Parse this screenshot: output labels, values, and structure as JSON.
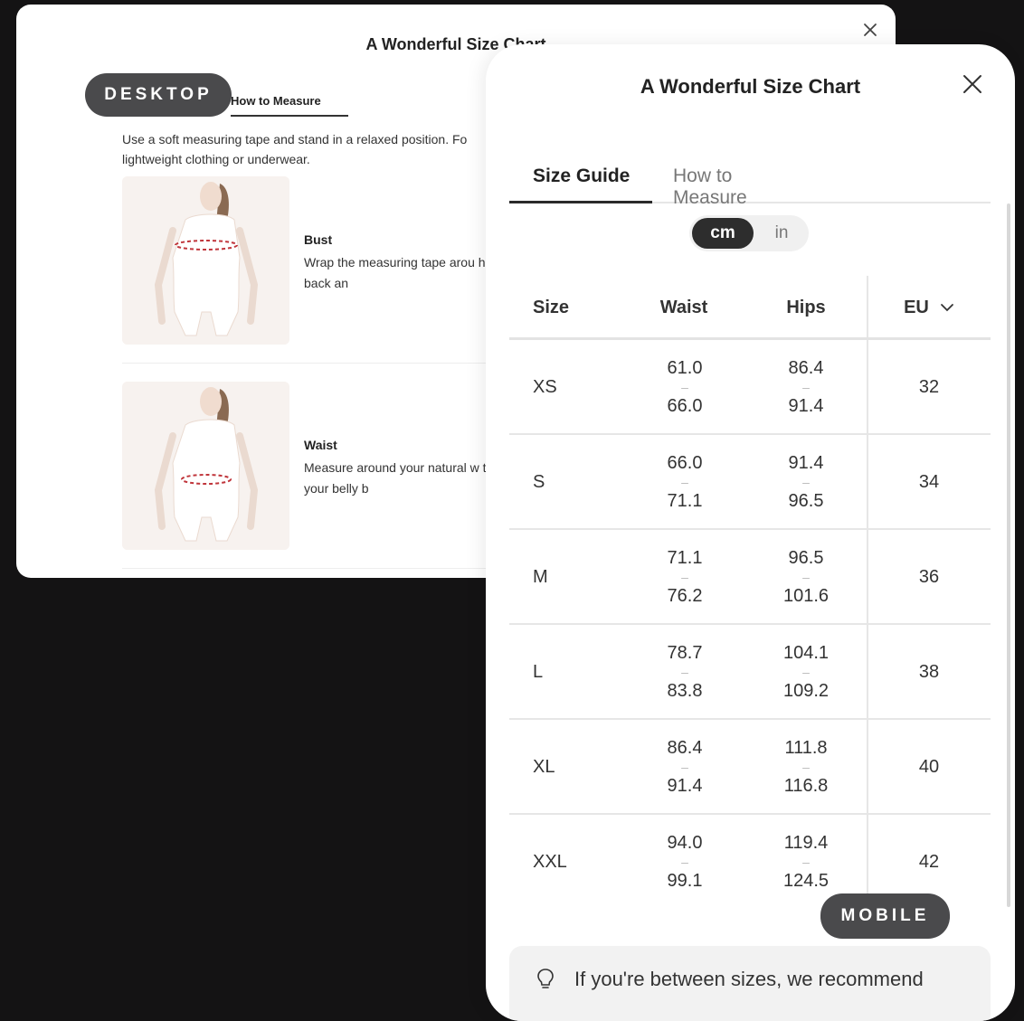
{
  "desktop": {
    "title": "A Wonderful Size Chart",
    "tab_how_to_measure": "How to Measure",
    "intro": "Use a soft measuring tape and stand in a relaxed position. Fo lightweight clothing or underwear.",
    "rows": [
      {
        "label": "Bust",
        "desc": "Wrap the measuring tape arou horizontal across your back an"
      },
      {
        "label": "Waist",
        "desc": "Measure around your natural w typically just above your belly b"
      }
    ]
  },
  "badges": {
    "desktop": "DESKTOP",
    "mobile": "MOBILE"
  },
  "mobile": {
    "title": "A Wonderful Size Chart",
    "tabs": [
      "Size Guide",
      "How to Measure"
    ],
    "units": {
      "selected": "cm",
      "other": "in"
    },
    "headers": {
      "size": "Size",
      "waist": "Waist",
      "hips": "Hips",
      "region": "EU"
    },
    "rows": [
      {
        "size": "XS",
        "waist_lo": "61.0",
        "waist_hi": "66.0",
        "hips_lo": "86.4",
        "hips_hi": "91.4",
        "eu": "32"
      },
      {
        "size": "S",
        "waist_lo": "66.0",
        "waist_hi": "71.1",
        "hips_lo": "91.4",
        "hips_hi": "96.5",
        "eu": "34"
      },
      {
        "size": "M",
        "waist_lo": "71.1",
        "waist_hi": "76.2",
        "hips_lo": "96.5",
        "hips_hi": "101.6",
        "eu": "36"
      },
      {
        "size": "L",
        "waist_lo": "78.7",
        "waist_hi": "83.8",
        "hips_lo": "104.1",
        "hips_hi": "109.2",
        "eu": "38"
      },
      {
        "size": "XL",
        "waist_lo": "86.4",
        "waist_hi": "91.4",
        "hips_lo": "111.8",
        "hips_hi": "116.8",
        "eu": "40"
      },
      {
        "size": "XXL",
        "waist_lo": "94.0",
        "waist_hi": "99.1",
        "hips_lo": "119.4",
        "hips_hi": "124.5",
        "eu": "42"
      }
    ],
    "range_dash": "–",
    "tip": "If you're between sizes, we recommend"
  },
  "colors": {
    "badge_bg": "#4a4a4c",
    "background": "#141314",
    "accent_dark": "#2d2d2d",
    "measure_line": "#c0353b"
  },
  "icons": {
    "close": "close-icon",
    "chevron": "chevron-down-icon",
    "bulb": "lightbulb-icon"
  }
}
